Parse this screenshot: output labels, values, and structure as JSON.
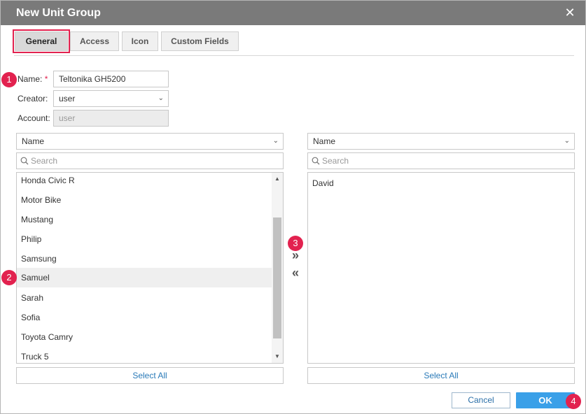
{
  "dialog": {
    "title": "New Unit Group",
    "close_glyph": "✕"
  },
  "tabs": [
    {
      "label": "General",
      "active": true
    },
    {
      "label": "Access",
      "active": false
    },
    {
      "label": "Icon",
      "active": false
    },
    {
      "label": "Custom Fields",
      "active": false
    }
  ],
  "form": {
    "name_label": "Name:",
    "name_required": "*",
    "name_value": "Teltonika GH5200",
    "creator_label": "Creator:",
    "creator_value": "user",
    "account_label": "Account:",
    "account_placeholder": "user"
  },
  "left_panel": {
    "sort_value": "Name",
    "search_placeholder": "Search",
    "items": [
      "Honda Civic R",
      "Motor Bike",
      "Mustang",
      "Philip",
      "Samsung",
      "Samuel",
      "Sarah",
      "Sofia",
      "Toyota Camry",
      "Truck 5"
    ],
    "hovered_item": "Samuel",
    "select_all_label": "Select All"
  },
  "right_panel": {
    "sort_value": "Name",
    "search_placeholder": "Search",
    "items": [
      "David"
    ],
    "select_all_label": "Select All"
  },
  "move": {
    "add_glyph": "»",
    "remove_glyph": "«"
  },
  "footer": {
    "cancel_label": "Cancel",
    "ok_label": "OK"
  },
  "badges": [
    "1",
    "2",
    "3",
    "4"
  ],
  "icons": {
    "close": "close-icon",
    "search": "search-icon",
    "dropdown": "chevron-down-icon",
    "add": "move-right-icon",
    "remove": "move-left-icon"
  },
  "colors": {
    "titlebar": "#7a7a7a",
    "accent": "#e2224f",
    "ok_button": "#3aa0e8",
    "link": "#2a7ab8"
  }
}
